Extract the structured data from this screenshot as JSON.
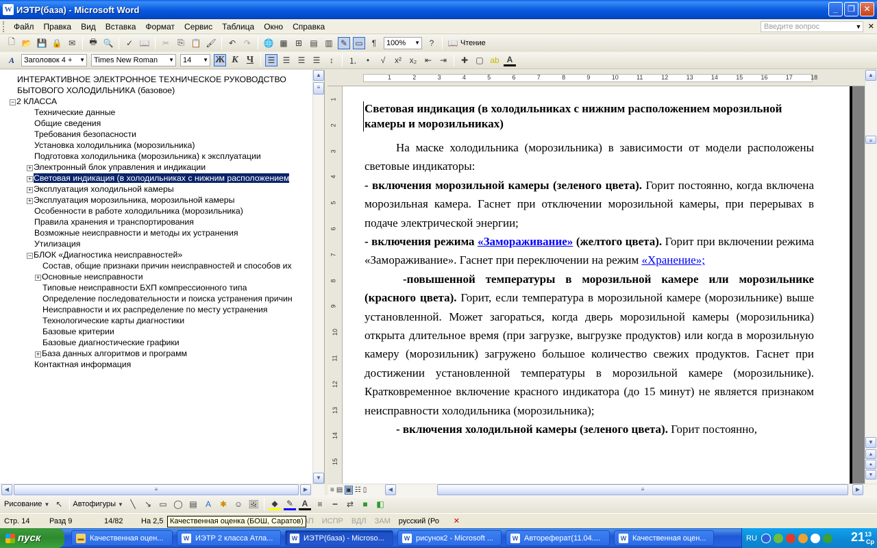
{
  "window": {
    "title": "ИЭТР(база) - Microsoft Word",
    "app_letter": "W"
  },
  "menu": {
    "items": [
      {
        "label": "Файл"
      },
      {
        "label": "Правка"
      },
      {
        "label": "Вид"
      },
      {
        "label": "Вставка"
      },
      {
        "label": "Формат"
      },
      {
        "label": "Сервис"
      },
      {
        "label": "Таблица"
      },
      {
        "label": "Окно"
      },
      {
        "label": "Справка"
      }
    ],
    "help_placeholder": "Введите вопрос"
  },
  "toolbar": {
    "zoom": "100%",
    "reading_label": "Чтение",
    "style": "Заголовок 4 +",
    "font": "Times New Roman",
    "size": "14"
  },
  "docmap": {
    "items": [
      {
        "text": "ИНТЕРАКТИВНОЕ ЭЛЕКТРОННОЕ ТЕХНИЧЕСКОЕ РУКОВОДСТВО",
        "indent": 25,
        "exp": ""
      },
      {
        "text": "БЫТОВОГО ХОЛОДИЛЬНИКА  (базовое)",
        "indent": 25,
        "exp": ""
      },
      {
        "text": "2 КЛАССА",
        "indent": 14,
        "exp": "−"
      },
      {
        "text": "Технические данные",
        "indent": 50,
        "exp": ""
      },
      {
        "text": "Общие сведения",
        "indent": 50,
        "exp": ""
      },
      {
        "text": "Требования безопасности",
        "indent": 50,
        "exp": ""
      },
      {
        "text": "Установка холодильника (морозильника)",
        "indent": 50,
        "exp": ""
      },
      {
        "text": "Подготовка холодильника (морозильника) к эксплуатации",
        "indent": 50,
        "exp": ""
      },
      {
        "text": "Электронный блок управления и индикации",
        "indent": 39,
        "exp": "+"
      },
      {
        "text": "Световая индикация (в холодильниках  с  нижним расположением",
        "indent": 39,
        "exp": "+",
        "selected": true
      },
      {
        "text": "Эксплуатация холодильной камеры",
        "indent": 39,
        "exp": "+"
      },
      {
        "text": "Эксплуатация морозильника, морозильной камеры",
        "indent": 39,
        "exp": "+"
      },
      {
        "text": "Особенности в работе холодильника (морозильника)",
        "indent": 50,
        "exp": ""
      },
      {
        "text": "Правила хранения и транспортирования",
        "indent": 50,
        "exp": ""
      },
      {
        "text": "Возможные неисправности и методы их устранения",
        "indent": 50,
        "exp": ""
      },
      {
        "text": "Утилизация",
        "indent": 50,
        "exp": ""
      },
      {
        "text": "БЛОК «Диагностика неисправностей»",
        "indent": 39,
        "exp": "−"
      },
      {
        "text": "Состав, общие признаки причин неисправностей и способов их",
        "indent": 62,
        "exp": ""
      },
      {
        "text": "Основные неисправности",
        "indent": 51,
        "exp": "+"
      },
      {
        "text": "Типовые неисправности БХП компрессионного типа",
        "indent": 62,
        "exp": ""
      },
      {
        "text": "Определение последовательности и поиска устранения причин",
        "indent": 62,
        "exp": ""
      },
      {
        "text": "Неисправности и их распределение по месту устранения",
        "indent": 62,
        "exp": ""
      },
      {
        "text": "Технологические карты диагностики",
        "indent": 62,
        "exp": ""
      },
      {
        "text": "Базовые критерии",
        "indent": 62,
        "exp": ""
      },
      {
        "text": "Базовые диагностические графики",
        "indent": 62,
        "exp": ""
      },
      {
        "text": "База данных  алгоритмов  и программ",
        "indent": 51,
        "exp": "+"
      },
      {
        "text": "Контактная информация",
        "indent": 50,
        "exp": ""
      }
    ]
  },
  "ruler": {
    "h_numbers": [
      "1",
      "2",
      "3",
      "4",
      "5",
      "6",
      "7",
      "8",
      "9",
      "10",
      "11",
      "12",
      "13",
      "14",
      "15",
      "16",
      "17",
      "18"
    ],
    "v_numbers": [
      "1",
      "2",
      "3",
      "4",
      "5",
      "6",
      "7",
      "8",
      "9",
      "10",
      "11",
      "12",
      "13",
      "14",
      "15"
    ]
  },
  "document": {
    "heading": "Световая индикация (в холодильниках  с  нижним расположением морозильной камеры и морозильниках)",
    "p1": "На маске холодильника (морозильника) в зависимости от модели расположены световые индикаторы:",
    "p2_bold": "- включения морозильной камеры (зеленого цвета).",
    "p2_rest": " Горит постоянно, когда включена морозильная камера. Гаснет при отключении морозильной камеры, при перерывах в подаче электрической энергии;",
    "p3_bold_a": "- включения режима ",
    "p3_link": "«Замораживание»",
    "p3_bold_b": " (желтого цвета).",
    "p3_rest": " Горит при включении режима «Замораживание». Гаснет при переключении на режим ",
    "p3_link2": "«Хранение»;",
    "p4_bold": "-повышенной температуры в морозильной камере или морозильнике (красного цвета).",
    "p4_rest": " Горит, если температура в морозильной камере (морозильнике) выше установленной. Может загораться, когда дверь морозильной камеры (морозильника) открыта длительное время (при загрузке, выгрузке продуктов) или когда в морозильную камеру (морозильник) загружено большое количество свежих продуктов. Гаснет при достижении установленной температуры в морозильной камере (морозильнике). Кратковременное включение красного индикатора (до 15 минут) не является признаком неисправности холодильника (морозильника);",
    "p5_bold": "- включения холодильной камеры (зеленого цвета).",
    "p5_rest": " Горит постоянно,"
  },
  "drawing": {
    "draw_label": "Рисование",
    "autoshapes_label": "Автофигуры"
  },
  "status": {
    "page": "Стр. 14",
    "section": "Разд 9",
    "pages": "14/82",
    "at": "На 2,5",
    "rec": "ЗАП",
    "trk": "ИСПР",
    "ext": "ВДЛ",
    "ovr": "ЗАМ",
    "lang": "русский (Ро",
    "tooltip": "Качественная оценка (БОШ, Саратов)"
  },
  "taskbar": {
    "start": "пуск",
    "tasks": [
      {
        "label": "Качественная оцен...",
        "icon": "folder"
      },
      {
        "label": "ИЭТР 2 класса Атла...",
        "icon": "word"
      },
      {
        "label": "ИЭТР(база) - Microso...",
        "icon": "word",
        "active": true
      },
      {
        "label": "рисунок2 - Microsoft ...",
        "icon": "word"
      },
      {
        "label": "Автореферат(11.04....",
        "icon": "word"
      },
      {
        "label": "Качественная оцен...",
        "icon": "word"
      }
    ],
    "lang": "RU",
    "clock_hm": "21",
    "clock_min": "13",
    "clock_day": "Ср"
  },
  "colors": {
    "selection": "#0a246a",
    "link": "#0000ff",
    "titlebar": "#0a5de0"
  }
}
